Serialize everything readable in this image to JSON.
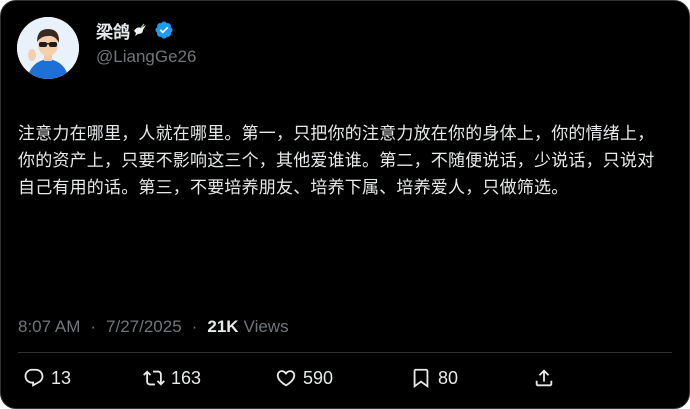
{
  "author": {
    "display_name": "梁鸽",
    "handle": "@LiangGe26",
    "name_emoji": "dove-icon",
    "verified": "verified-badge-icon",
    "avatar": "avatar-photo"
  },
  "tweet": {
    "text": "注意力在哪里，人就在哪里。第一，只把你的注意力放在你的身体上，你的情绪上，你的资产上，只要不影响这三个，其他爱谁谁。第二，不随便说话，少说话，只说对自己有用的话。第三，不要培养朋友、培养下属、培养爱人，只做筛选。"
  },
  "meta": {
    "time": "8:07 AM",
    "separator": "·",
    "date": "7/27/2025",
    "views_count": "21K",
    "views_label": "Views"
  },
  "actions": {
    "reply": {
      "icon": "reply-icon",
      "count": "13"
    },
    "retweet": {
      "icon": "retweet-icon",
      "count": "163"
    },
    "like": {
      "icon": "heart-icon",
      "count": "590"
    },
    "bookmark": {
      "icon": "bookmark-icon",
      "count": "80"
    },
    "share": {
      "icon": "share-icon"
    }
  },
  "colors": {
    "background": "#000000",
    "text": "#e7e9ea",
    "muted": "#71767b",
    "verified": "#1d9bf0",
    "border": "#2f3336"
  }
}
